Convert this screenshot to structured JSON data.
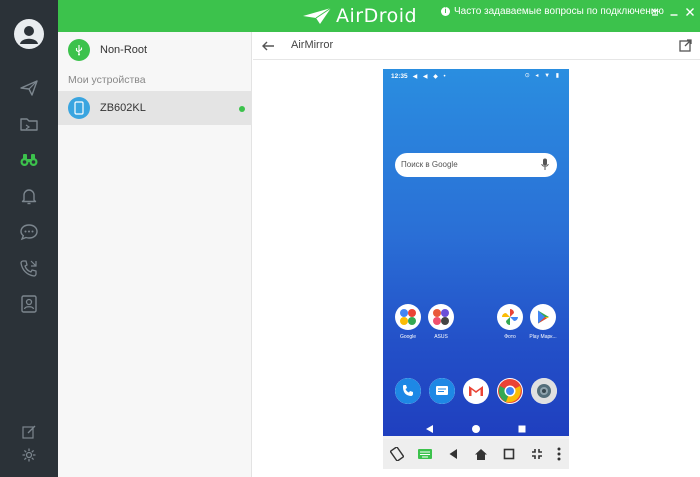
{
  "app": {
    "logo_text": "AirDroid",
    "faq_text": "Часто задаваемые вопросы по подключению",
    "colors": {
      "brand_green": "#3cc24c",
      "rail_dark": "#2b3238",
      "device_blue": "#3aa5e0"
    }
  },
  "rail": {
    "items": [
      {
        "icon": "send-icon"
      },
      {
        "icon": "folder-icon"
      },
      {
        "icon": "binoculars-icon",
        "active": true
      },
      {
        "icon": "bell-icon"
      },
      {
        "icon": "chat-icon"
      },
      {
        "icon": "phone-call-icon"
      },
      {
        "icon": "contacts-icon"
      }
    ],
    "bottom": [
      {
        "icon": "edit-icon"
      },
      {
        "icon": "settings-icon"
      }
    ]
  },
  "devices": {
    "nonroot_label": "Non-Root",
    "section_title": "Мои устройства",
    "list": [
      {
        "name": "ZB602KL",
        "online": true
      }
    ]
  },
  "main": {
    "title": "AirMirror"
  },
  "phone": {
    "status_time": "12:35",
    "search_placeholder": "Поиск в Google",
    "apps": [
      {
        "label": "Google",
        "icon": "google-folder-icon"
      },
      {
        "label": "ASUS",
        "icon": "asus-folder-icon"
      },
      {
        "label": "Фото",
        "icon": "photos-icon"
      },
      {
        "label": "Play Марк...",
        "icon": "play-store-icon"
      }
    ],
    "dock": [
      {
        "icon": "phone-app-icon"
      },
      {
        "icon": "messages-app-icon"
      },
      {
        "icon": "gmail-app-icon"
      },
      {
        "icon": "chrome-app-icon"
      },
      {
        "icon": "camera-app-icon"
      }
    ]
  }
}
